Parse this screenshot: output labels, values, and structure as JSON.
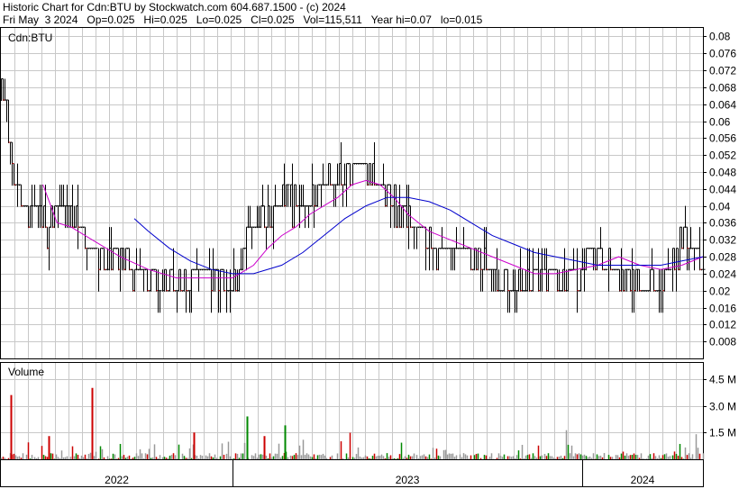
{
  "header": {
    "title": "Historic Chart for Cdn:BTU by Stockwatch.com 604.687.1500 - (c) 2024",
    "summary": "Fri May  3 2024   Op=0.025   Hi=0.025   Lo=0.025   Cl=0.025   Vol=115,511   Year hi=0.07   lo=0.015"
  },
  "colors": {
    "price_bar": "#000000",
    "price_bar_down": "#cc0000",
    "ma_short": "#cc00cc",
    "ma_long": "#0000cc",
    "vol_up": "#008800",
    "vol_down": "#cc0000",
    "vol_flat": "#999999",
    "grid": "#c8c8c8"
  },
  "chart_data": [
    {
      "type": "line",
      "title": "Cdn:BTU",
      "y_axis_side": "right",
      "ylim": [
        0.004,
        0.082
      ],
      "y_ticks": [
        "0.08",
        "0.076",
        "0.072",
        "0.068",
        "0.064",
        "0.06",
        "0.056",
        "0.052",
        "0.048",
        "0.044",
        "0.04",
        "0.036",
        "0.032",
        "0.028",
        "0.024",
        "0.02",
        "0.016",
        "0.012",
        "0.008"
      ],
      "x_labels": [
        "2022",
        "2023",
        "2024"
      ],
      "grid": true,
      "price_path": [
        [
          0.0,
          0.07
        ],
        [
          0.01,
          0.06
        ],
        [
          0.02,
          0.045
        ],
        [
          0.035,
          0.04
        ],
        [
          0.05,
          0.04
        ],
        [
          0.065,
          0.035
        ],
        [
          0.08,
          0.038
        ],
        [
          0.095,
          0.04
        ],
        [
          0.11,
          0.035
        ],
        [
          0.13,
          0.028
        ],
        [
          0.15,
          0.028
        ],
        [
          0.17,
          0.028
        ],
        [
          0.19,
          0.025
        ],
        [
          0.205,
          0.025
        ],
        [
          0.22,
          0.022
        ],
        [
          0.235,
          0.022
        ],
        [
          0.25,
          0.022
        ],
        [
          0.265,
          0.022
        ],
        [
          0.28,
          0.025
        ],
        [
          0.295,
          0.025
        ],
        [
          0.31,
          0.022
        ],
        [
          0.325,
          0.022
        ],
        [
          0.34,
          0.025
        ],
        [
          0.355,
          0.036
        ],
        [
          0.37,
          0.036
        ],
        [
          0.385,
          0.038
        ],
        [
          0.4,
          0.042
        ],
        [
          0.415,
          0.04
        ],
        [
          0.43,
          0.04
        ],
        [
          0.445,
          0.04
        ],
        [
          0.46,
          0.045
        ],
        [
          0.475,
          0.048
        ],
        [
          0.49,
          0.05
        ],
        [
          0.505,
          0.05
        ],
        [
          0.52,
          0.048
        ],
        [
          0.54,
          0.045
        ],
        [
          0.56,
          0.04
        ],
        [
          0.575,
          0.038
        ],
        [
          0.59,
          0.035
        ],
        [
          0.605,
          0.032
        ],
        [
          0.62,
          0.03
        ],
        [
          0.64,
          0.03
        ],
        [
          0.66,
          0.03
        ],
        [
          0.68,
          0.028
        ],
        [
          0.7,
          0.025
        ],
        [
          0.715,
          0.022
        ],
        [
          0.73,
          0.022
        ],
        [
          0.745,
          0.022
        ],
        [
          0.76,
          0.025
        ],
        [
          0.775,
          0.025
        ],
        [
          0.79,
          0.022
        ],
        [
          0.805,
          0.025
        ],
        [
          0.82,
          0.022
        ],
        [
          0.835,
          0.03
        ],
        [
          0.85,
          0.03
        ],
        [
          0.865,
          0.025
        ],
        [
          0.88,
          0.025
        ],
        [
          0.895,
          0.022
        ],
        [
          0.91,
          0.022
        ],
        [
          0.925,
          0.022
        ],
        [
          0.94,
          0.022
        ],
        [
          0.955,
          0.025
        ],
        [
          0.97,
          0.032
        ],
        [
          0.985,
          0.03
        ],
        [
          1.0,
          0.025
        ]
      ],
      "series": [
        {
          "values": [
            [
              0.06,
              0.045
            ],
            [
              0.08,
              0.036
            ],
            [
              0.1,
              0.035
            ],
            [
              0.13,
              0.032
            ],
            [
              0.17,
              0.028
            ],
            [
              0.21,
              0.025
            ],
            [
              0.25,
              0.023
            ],
            [
              0.29,
              0.023
            ],
            [
              0.33,
              0.023
            ],
            [
              0.36,
              0.026
            ],
            [
              0.38,
              0.03
            ],
            [
              0.4,
              0.033
            ],
            [
              0.42,
              0.035
            ],
            [
              0.44,
              0.038
            ],
            [
              0.46,
              0.04
            ],
            [
              0.48,
              0.042
            ],
            [
              0.5,
              0.045
            ],
            [
              0.52,
              0.046
            ],
            [
              0.54,
              0.045
            ],
            [
              0.56,
              0.042
            ],
            [
              0.58,
              0.038
            ],
            [
              0.61,
              0.034
            ],
            [
              0.64,
              0.032
            ],
            [
              0.67,
              0.03
            ],
            [
              0.7,
              0.028
            ],
            [
              0.73,
              0.026
            ],
            [
              0.76,
              0.024
            ],
            [
              0.79,
              0.024
            ],
            [
              0.82,
              0.025
            ],
            [
              0.85,
              0.026
            ],
            [
              0.88,
              0.028
            ],
            [
              0.91,
              0.026
            ],
            [
              0.94,
              0.025
            ],
            [
              0.97,
              0.026
            ],
            [
              1.0,
              0.028
            ]
          ]
        },
        {
          "values": [
            [
              0.19,
              0.037
            ],
            [
              0.21,
              0.034
            ],
            [
              0.24,
              0.03
            ],
            [
              0.27,
              0.027
            ],
            [
              0.3,
              0.025
            ],
            [
              0.33,
              0.024
            ],
            [
              0.36,
              0.024
            ],
            [
              0.4,
              0.026
            ],
            [
              0.43,
              0.029
            ],
            [
              0.46,
              0.033
            ],
            [
              0.49,
              0.037
            ],
            [
              0.52,
              0.04
            ],
            [
              0.55,
              0.042
            ],
            [
              0.58,
              0.042
            ],
            [
              0.61,
              0.041
            ],
            [
              0.64,
              0.039
            ],
            [
              0.67,
              0.036
            ],
            [
              0.7,
              0.033
            ],
            [
              0.73,
              0.031
            ],
            [
              0.76,
              0.029
            ],
            [
              0.79,
              0.028
            ],
            [
              0.82,
              0.027
            ],
            [
              0.85,
              0.026
            ],
            [
              0.88,
              0.026
            ],
            [
              0.91,
              0.026
            ],
            [
              0.94,
              0.026
            ],
            [
              0.97,
              0.027
            ],
            [
              1.0,
              0.028
            ]
          ]
        }
      ]
    },
    {
      "type": "bar",
      "title": "Volume",
      "y_axis_side": "right",
      "ylim": [
        0,
        5.4
      ],
      "y_ticks": [
        "4.5 M",
        "3.0 M",
        "1.5 M"
      ],
      "y_tick_values": [
        4.5,
        3.0,
        1.5
      ],
      "grid": true
    }
  ]
}
